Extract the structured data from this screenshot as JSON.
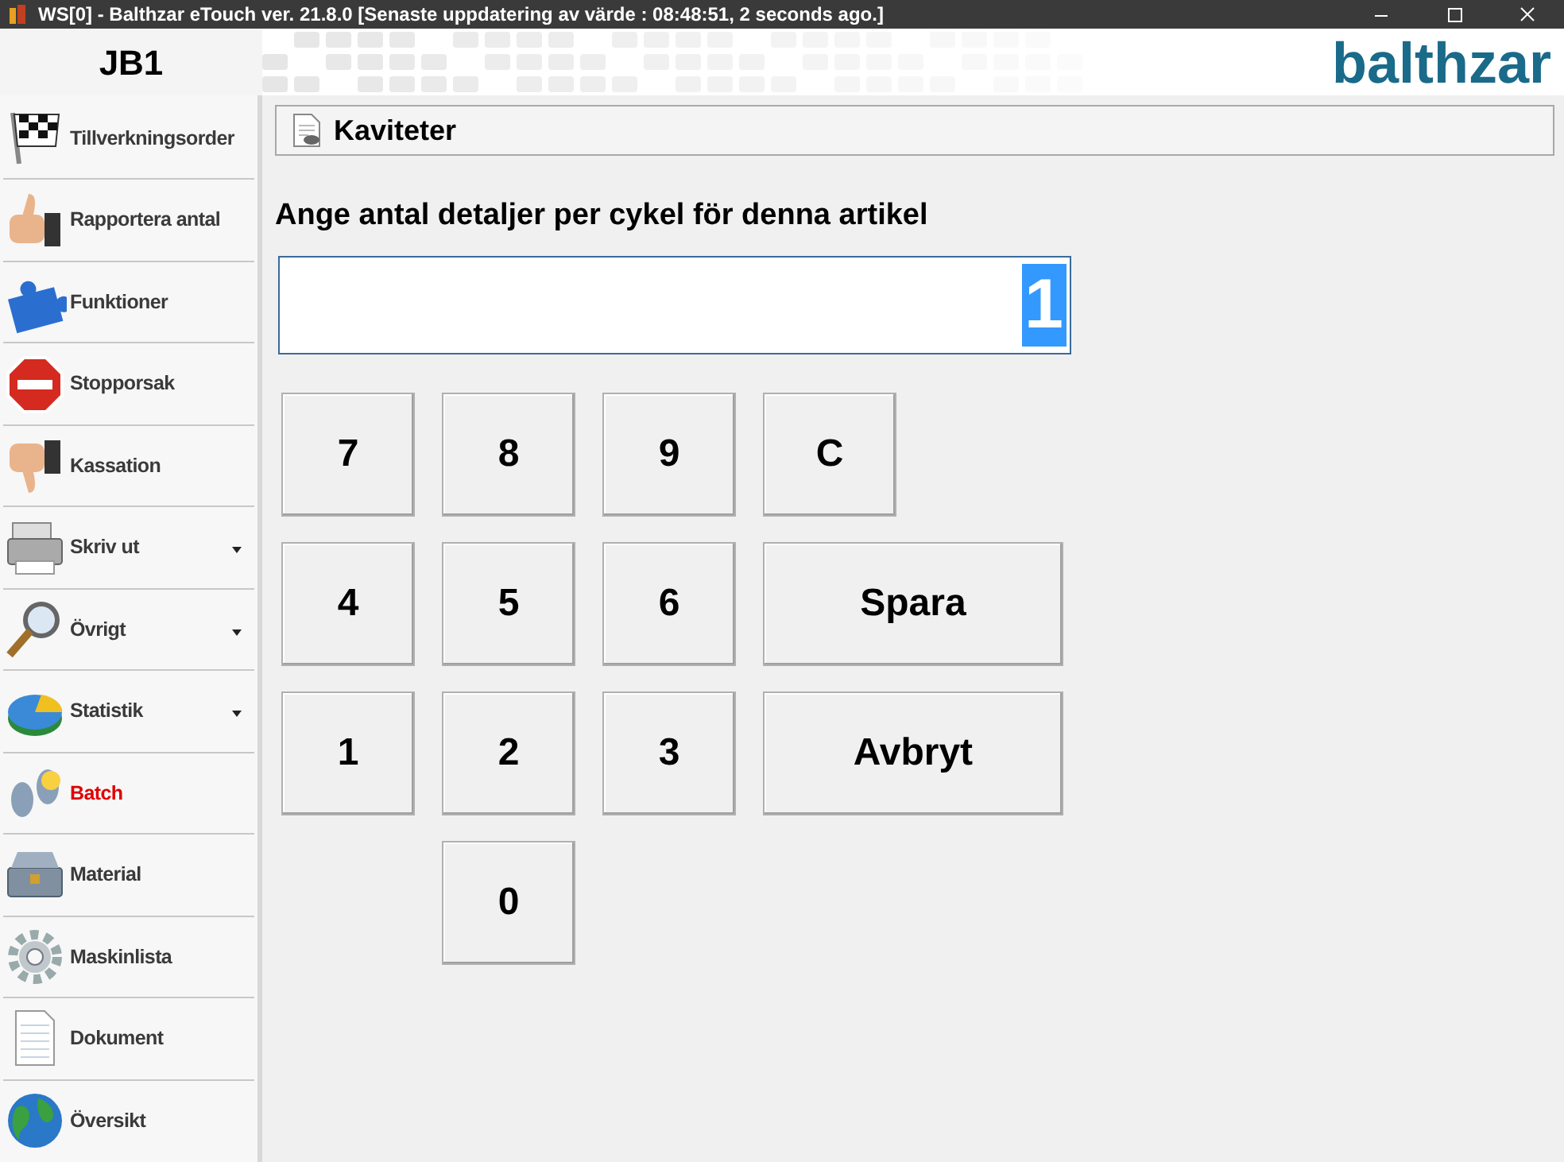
{
  "window": {
    "title": "WS[0] - Balthzar eTouch ver. 21.8.0  [Senaste uppdatering av värde : 08:48:51, 2 seconds ago.]"
  },
  "header": {
    "station": "JB1",
    "logo": "balthzar"
  },
  "sidebar": {
    "items": [
      {
        "label": "Tillverkningsorder",
        "selected": false,
        "has_menu": false
      },
      {
        "label": "Rapportera antal",
        "selected": false,
        "has_menu": false
      },
      {
        "label": "Funktioner",
        "selected": false,
        "has_menu": false
      },
      {
        "label": "Stopporsak",
        "selected": false,
        "has_menu": false
      },
      {
        "label": "Kassation",
        "selected": false,
        "has_menu": false
      },
      {
        "label": "Skriv ut",
        "selected": false,
        "has_menu": true
      },
      {
        "label": "Övrigt",
        "selected": false,
        "has_menu": true
      },
      {
        "label": "Statistik",
        "selected": false,
        "has_menu": true
      },
      {
        "label": "Batch",
        "selected": true,
        "has_menu": false
      },
      {
        "label": "Material",
        "selected": false,
        "has_menu": false
      },
      {
        "label": "Maskinlista",
        "selected": false,
        "has_menu": false
      },
      {
        "label": "Dokument",
        "selected": false,
        "has_menu": false
      },
      {
        "label": "Översikt",
        "selected": false,
        "has_menu": false
      }
    ]
  },
  "panel": {
    "title": "Kaviteter",
    "prompt": "Ange antal detaljer per cykel  för denna artikel",
    "value": "1",
    "keys": [
      {
        "label": "7",
        "kind": "key"
      },
      {
        "label": "8",
        "kind": "key"
      },
      {
        "label": "9",
        "kind": "key"
      },
      {
        "label": "C",
        "kind": "key"
      },
      {
        "label": "4",
        "kind": "key"
      },
      {
        "label": "5",
        "kind": "key"
      },
      {
        "label": "6",
        "kind": "key"
      },
      {
        "label": "Spara",
        "kind": "wide"
      },
      {
        "label": "1",
        "kind": "key"
      },
      {
        "label": "2",
        "kind": "key"
      },
      {
        "label": "3",
        "kind": "key"
      },
      {
        "label": "Avbryt",
        "kind": "wide"
      },
      {
        "label": "0",
        "kind": "zero"
      }
    ]
  }
}
